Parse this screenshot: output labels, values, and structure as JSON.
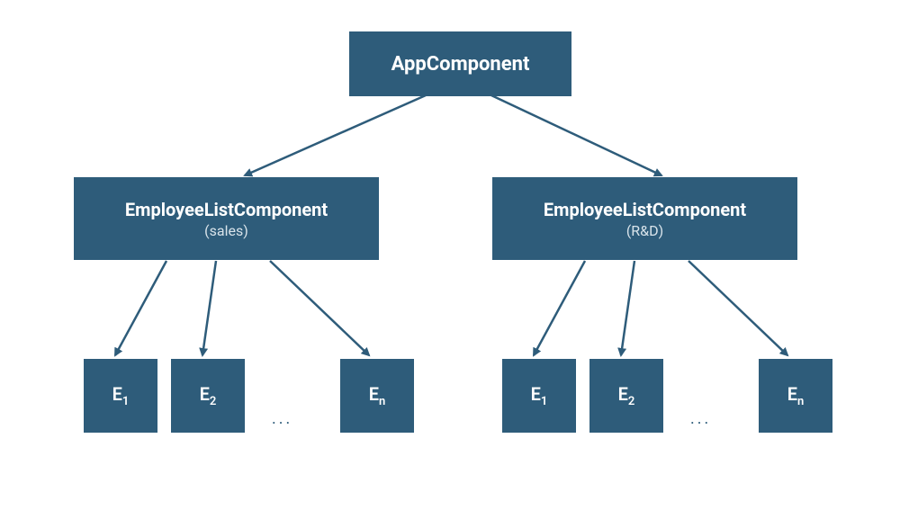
{
  "colors": {
    "node_bg": "#2e5c7a",
    "node_fg": "#ffffff"
  },
  "root": {
    "title": "AppComponent"
  },
  "lists": [
    {
      "title": "EmployeeListComponent",
      "subtitle": "(sales)"
    },
    {
      "title": "EmployeeListComponent",
      "subtitle": "(R&D)"
    }
  ],
  "leaf_labels": {
    "e1": {
      "base": "E",
      "sub": "1"
    },
    "e2": {
      "base": "E",
      "sub": "2"
    },
    "en": {
      "base": "E",
      "sub": "n"
    }
  },
  "ellipsis": "..."
}
